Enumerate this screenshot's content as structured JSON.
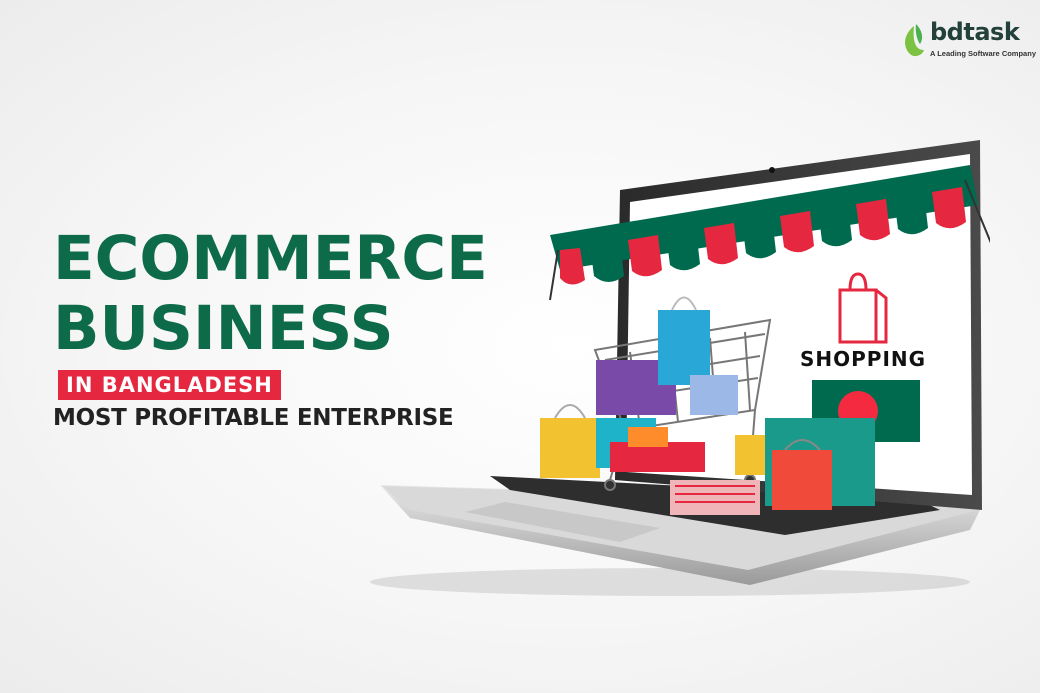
{
  "logo": {
    "name": "bdtask",
    "tagline": "A Leading Software Company"
  },
  "headline": {
    "line1": "ECOMMERCE",
    "line2": "BUSINESS",
    "tag": "IN BANGLADESH",
    "subtitle": "MOST PROFITABLE ENTERPRISE"
  },
  "illustration": {
    "screen_text": "SHOPPING",
    "icons": [
      "shopping-bag-icon",
      "bangladesh-flag",
      "shopping-cart",
      "awning"
    ]
  },
  "colors": {
    "brand_green": "#0e6b4a",
    "accent_red": "#e5283f",
    "flag_green": "#006a4e",
    "flag_red": "#f42a41"
  }
}
